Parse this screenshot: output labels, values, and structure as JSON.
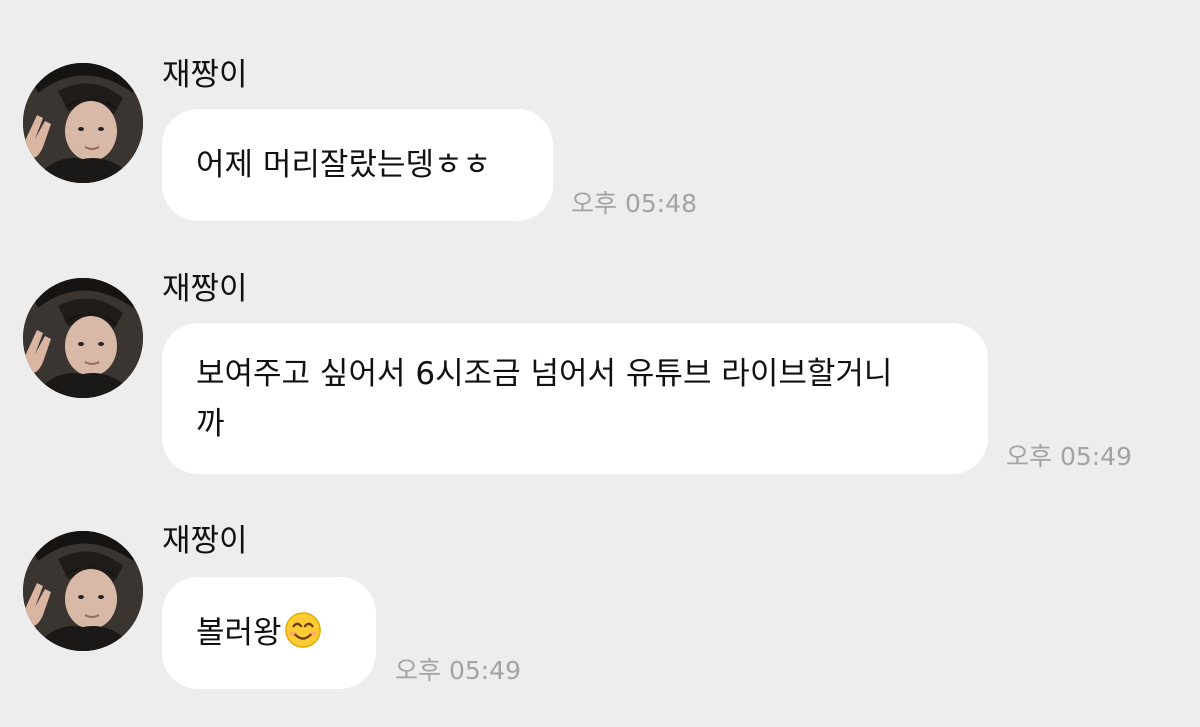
{
  "chat": {
    "messages": [
      {
        "sender": "재짱이",
        "text": "어제 머리잘랐는뎅ㅎㅎ",
        "time": "오후 05:48"
      },
      {
        "sender": "재짱이",
        "text_line1": "보여주고 싶어서 6시조금 넘어서 유튜브 라이브할거니",
        "text_line2": "까",
        "time": "오후 05:49"
      },
      {
        "sender": "재짱이",
        "text": "볼러왕",
        "emoji": "smiling-face-emoji",
        "time": "오후 05:49"
      }
    ]
  }
}
